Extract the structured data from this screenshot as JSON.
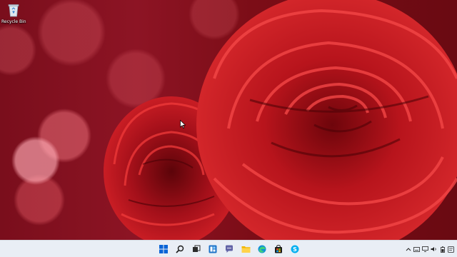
{
  "desktop": {
    "wallpaper": "red-roses",
    "icons": [
      {
        "label": "Recycle Bin",
        "icon": "recycle-bin-icon"
      }
    ]
  },
  "taskbar": {
    "pinned": [
      {
        "name": "start",
        "icon": "windows-logo-icon"
      },
      {
        "name": "search",
        "icon": "search-icon"
      },
      {
        "name": "task-view",
        "icon": "task-view-icon"
      },
      {
        "name": "widgets",
        "icon": "widgets-icon"
      },
      {
        "name": "chat",
        "icon": "chat-icon"
      },
      {
        "name": "file-explorer",
        "icon": "folder-icon"
      },
      {
        "name": "edge",
        "icon": "edge-icon"
      },
      {
        "name": "store",
        "icon": "store-icon"
      },
      {
        "name": "skype",
        "icon": "skype-icon"
      }
    ],
    "tray": [
      "chevron-up-icon",
      "network-icon",
      "volume-icon",
      "battery-icon",
      "language-icon"
    ]
  },
  "colors": {
    "taskbar_bg": "#e9eef5",
    "accent": "#0a64d6"
  }
}
